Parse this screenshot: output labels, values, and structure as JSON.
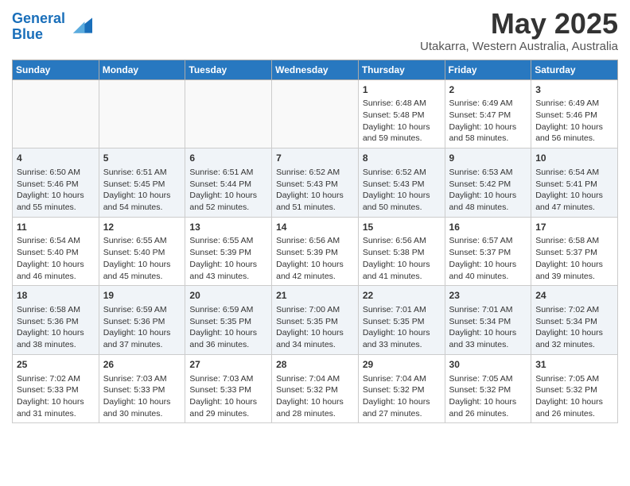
{
  "header": {
    "logo_line1": "General",
    "logo_line2": "Blue",
    "title": "May 2025",
    "location": "Utakarra, Western Australia, Australia"
  },
  "weekdays": [
    "Sunday",
    "Monday",
    "Tuesday",
    "Wednesday",
    "Thursday",
    "Friday",
    "Saturday"
  ],
  "weeks": [
    [
      {
        "day": "",
        "sunrise": "",
        "sunset": "",
        "daylight": ""
      },
      {
        "day": "",
        "sunrise": "",
        "sunset": "",
        "daylight": ""
      },
      {
        "day": "",
        "sunrise": "",
        "sunset": "",
        "daylight": ""
      },
      {
        "day": "",
        "sunrise": "",
        "sunset": "",
        "daylight": ""
      },
      {
        "day": "1",
        "sunrise": "Sunrise: 6:48 AM",
        "sunset": "Sunset: 5:48 PM",
        "daylight": "Daylight: 10 hours and 59 minutes."
      },
      {
        "day": "2",
        "sunrise": "Sunrise: 6:49 AM",
        "sunset": "Sunset: 5:47 PM",
        "daylight": "Daylight: 10 hours and 58 minutes."
      },
      {
        "day": "3",
        "sunrise": "Sunrise: 6:49 AM",
        "sunset": "Sunset: 5:46 PM",
        "daylight": "Daylight: 10 hours and 56 minutes."
      }
    ],
    [
      {
        "day": "4",
        "sunrise": "Sunrise: 6:50 AM",
        "sunset": "Sunset: 5:46 PM",
        "daylight": "Daylight: 10 hours and 55 minutes."
      },
      {
        "day": "5",
        "sunrise": "Sunrise: 6:51 AM",
        "sunset": "Sunset: 5:45 PM",
        "daylight": "Daylight: 10 hours and 54 minutes."
      },
      {
        "day": "6",
        "sunrise": "Sunrise: 6:51 AM",
        "sunset": "Sunset: 5:44 PM",
        "daylight": "Daylight: 10 hours and 52 minutes."
      },
      {
        "day": "7",
        "sunrise": "Sunrise: 6:52 AM",
        "sunset": "Sunset: 5:43 PM",
        "daylight": "Daylight: 10 hours and 51 minutes."
      },
      {
        "day": "8",
        "sunrise": "Sunrise: 6:52 AM",
        "sunset": "Sunset: 5:43 PM",
        "daylight": "Daylight: 10 hours and 50 minutes."
      },
      {
        "day": "9",
        "sunrise": "Sunrise: 6:53 AM",
        "sunset": "Sunset: 5:42 PM",
        "daylight": "Daylight: 10 hours and 48 minutes."
      },
      {
        "day": "10",
        "sunrise": "Sunrise: 6:54 AM",
        "sunset": "Sunset: 5:41 PM",
        "daylight": "Daylight: 10 hours and 47 minutes."
      }
    ],
    [
      {
        "day": "11",
        "sunrise": "Sunrise: 6:54 AM",
        "sunset": "Sunset: 5:40 PM",
        "daylight": "Daylight: 10 hours and 46 minutes."
      },
      {
        "day": "12",
        "sunrise": "Sunrise: 6:55 AM",
        "sunset": "Sunset: 5:40 PM",
        "daylight": "Daylight: 10 hours and 45 minutes."
      },
      {
        "day": "13",
        "sunrise": "Sunrise: 6:55 AM",
        "sunset": "Sunset: 5:39 PM",
        "daylight": "Daylight: 10 hours and 43 minutes."
      },
      {
        "day": "14",
        "sunrise": "Sunrise: 6:56 AM",
        "sunset": "Sunset: 5:39 PM",
        "daylight": "Daylight: 10 hours and 42 minutes."
      },
      {
        "day": "15",
        "sunrise": "Sunrise: 6:56 AM",
        "sunset": "Sunset: 5:38 PM",
        "daylight": "Daylight: 10 hours and 41 minutes."
      },
      {
        "day": "16",
        "sunrise": "Sunrise: 6:57 AM",
        "sunset": "Sunset: 5:37 PM",
        "daylight": "Daylight: 10 hours and 40 minutes."
      },
      {
        "day": "17",
        "sunrise": "Sunrise: 6:58 AM",
        "sunset": "Sunset: 5:37 PM",
        "daylight": "Daylight: 10 hours and 39 minutes."
      }
    ],
    [
      {
        "day": "18",
        "sunrise": "Sunrise: 6:58 AM",
        "sunset": "Sunset: 5:36 PM",
        "daylight": "Daylight: 10 hours and 38 minutes."
      },
      {
        "day": "19",
        "sunrise": "Sunrise: 6:59 AM",
        "sunset": "Sunset: 5:36 PM",
        "daylight": "Daylight: 10 hours and 37 minutes."
      },
      {
        "day": "20",
        "sunrise": "Sunrise: 6:59 AM",
        "sunset": "Sunset: 5:35 PM",
        "daylight": "Daylight: 10 hours and 36 minutes."
      },
      {
        "day": "21",
        "sunrise": "Sunrise: 7:00 AM",
        "sunset": "Sunset: 5:35 PM",
        "daylight": "Daylight: 10 hours and 34 minutes."
      },
      {
        "day": "22",
        "sunrise": "Sunrise: 7:01 AM",
        "sunset": "Sunset: 5:35 PM",
        "daylight": "Daylight: 10 hours and 33 minutes."
      },
      {
        "day": "23",
        "sunrise": "Sunrise: 7:01 AM",
        "sunset": "Sunset: 5:34 PM",
        "daylight": "Daylight: 10 hours and 33 minutes."
      },
      {
        "day": "24",
        "sunrise": "Sunrise: 7:02 AM",
        "sunset": "Sunset: 5:34 PM",
        "daylight": "Daylight: 10 hours and 32 minutes."
      }
    ],
    [
      {
        "day": "25",
        "sunrise": "Sunrise: 7:02 AM",
        "sunset": "Sunset: 5:33 PM",
        "daylight": "Daylight: 10 hours and 31 minutes."
      },
      {
        "day": "26",
        "sunrise": "Sunrise: 7:03 AM",
        "sunset": "Sunset: 5:33 PM",
        "daylight": "Daylight: 10 hours and 30 minutes."
      },
      {
        "day": "27",
        "sunrise": "Sunrise: 7:03 AM",
        "sunset": "Sunset: 5:33 PM",
        "daylight": "Daylight: 10 hours and 29 minutes."
      },
      {
        "day": "28",
        "sunrise": "Sunrise: 7:04 AM",
        "sunset": "Sunset: 5:32 PM",
        "daylight": "Daylight: 10 hours and 28 minutes."
      },
      {
        "day": "29",
        "sunrise": "Sunrise: 7:04 AM",
        "sunset": "Sunset: 5:32 PM",
        "daylight": "Daylight: 10 hours and 27 minutes."
      },
      {
        "day": "30",
        "sunrise": "Sunrise: 7:05 AM",
        "sunset": "Sunset: 5:32 PM",
        "daylight": "Daylight: 10 hours and 26 minutes."
      },
      {
        "day": "31",
        "sunrise": "Sunrise: 7:05 AM",
        "sunset": "Sunset: 5:32 PM",
        "daylight": "Daylight: 10 hours and 26 minutes."
      }
    ]
  ]
}
